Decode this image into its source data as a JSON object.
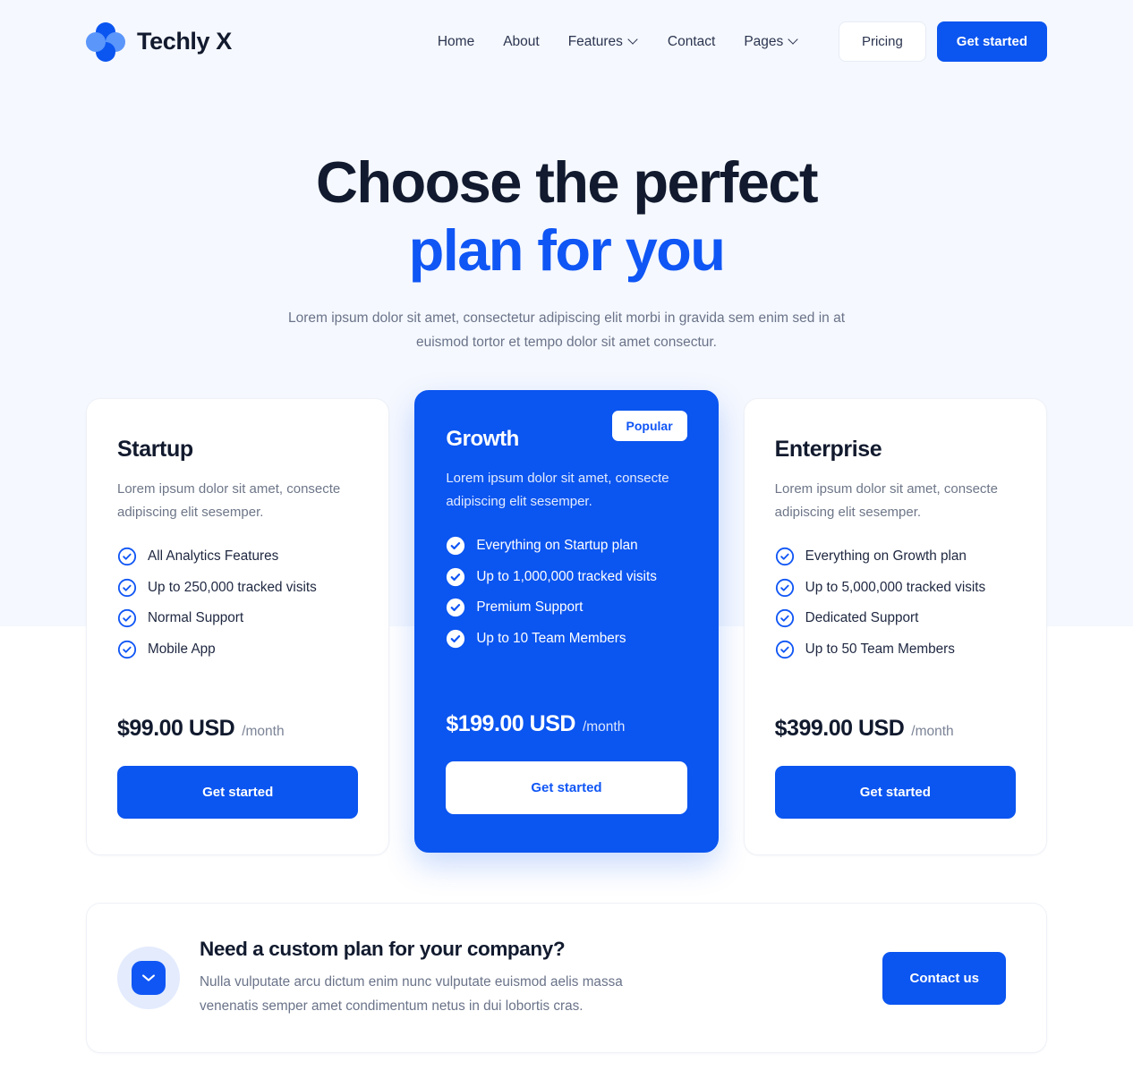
{
  "brand": {
    "name": "Techly X",
    "logo_icon": "techly-x-logo-icon",
    "logo_colors": {
      "dark": "#0b55f0",
      "light": "#5b96fb"
    }
  },
  "nav": {
    "items": [
      {
        "label": "Home",
        "has_dropdown": false
      },
      {
        "label": "About",
        "has_dropdown": false
      },
      {
        "label": "Features",
        "has_dropdown": true
      },
      {
        "label": "Contact",
        "has_dropdown": false
      },
      {
        "label": "Pages",
        "has_dropdown": true
      }
    ],
    "pricing_label": "Pricing",
    "get_started_label": "Get started"
  },
  "hero": {
    "title_line1": "Choose the perfect",
    "title_line2": "plan for you",
    "subtitle": "Lorem ipsum dolor sit amet, consectetur adipiscing elit morbi in gravida sem enim sed in at euismod tortor et tempo dolor sit amet consectur.",
    "accent_color": "#1056f5"
  },
  "plans": [
    {
      "name": "Startup",
      "description": "Lorem ipsum dolor sit amet, consecte adipiscing elit sesemper.",
      "features": [
        "All Analytics Features",
        "Up to 250,000 tracked visits",
        "Normal Support",
        "Mobile App"
      ],
      "price": "$99.00 USD",
      "period": "/month",
      "cta_label": "Get started",
      "featured": false,
      "badge": null
    },
    {
      "name": "Growth",
      "description": "Lorem ipsum dolor sit amet, consecte adipiscing elit sesemper.",
      "features": [
        "Everything on Startup plan",
        "Up to 1,000,000 tracked visits",
        "Premium Support",
        "Up to 10 Team Members"
      ],
      "price": "$199.00 USD",
      "period": "/month",
      "cta_label": "Get started",
      "featured": true,
      "badge": "Popular"
    },
    {
      "name": "Enterprise",
      "description": "Lorem ipsum dolor sit amet, consecte adipiscing elit sesemper.",
      "features": [
        "Everything on Growth plan",
        "Up to 5,000,000 tracked visits",
        "Dedicated Support",
        "Up to 50 Team Members"
      ],
      "price": "$399.00 USD",
      "period": "/month",
      "cta_label": "Get started",
      "featured": false,
      "badge": null
    }
  ],
  "custom_plan": {
    "icon": "mail-icon",
    "title": "Need a custom plan for your company?",
    "description": "Nulla vulputate arcu dictum enim nunc vulputate euismod aelis massa venenatis semper amet condimentum netus in dui lobortis cras.",
    "cta_label": "Contact us"
  },
  "theme": {
    "primary": "#0b55f0",
    "hero_background": "#f5f8fe",
    "page_background": "#ffffff",
    "text_dark": "#111a2e",
    "text_muted": "#6a7389"
  }
}
